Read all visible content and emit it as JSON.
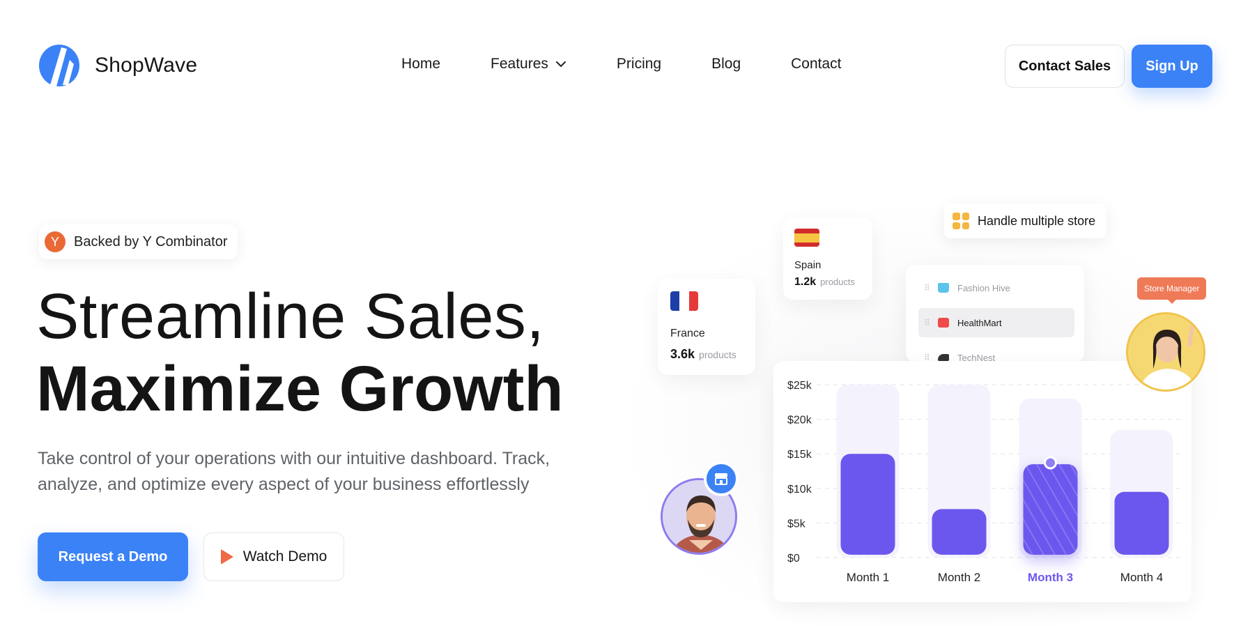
{
  "brand": {
    "name": "ShopWave",
    "accent": "#3b82f6"
  },
  "nav": {
    "items": [
      {
        "label": "Home"
      },
      {
        "label": "Features",
        "has_dropdown": true,
        "icon": "chevron-down-icon"
      },
      {
        "label": "Pricing"
      },
      {
        "label": "Blog"
      },
      {
        "label": "Contact"
      }
    ],
    "contact_sales": "Contact Sales",
    "sign_up": "Sign Up"
  },
  "hero": {
    "badge": {
      "icon_letter": "Y",
      "text": "Backed by Y Combinator"
    },
    "title_line1": "Streamline Sales,",
    "title_line2": "Maximize Growth",
    "subtitle": "Take control of your operations with our intuitive dashboard. Track, analyze, and optimize every aspect of your business effortlessly",
    "primary_cta": "Request a Demo",
    "secondary_cta": "Watch Demo"
  },
  "illustration": {
    "france": {
      "country": "France",
      "count": "3.6k",
      "unit": "products"
    },
    "spain": {
      "country": "Spain",
      "count": "1.2k",
      "unit": "products"
    },
    "handle_store": "Handle multiple store",
    "stores": [
      {
        "name": "Fashion Hive",
        "icon": "shirt-icon",
        "color": "#5cc4e8"
      },
      {
        "name": "HealthMart",
        "icon": "camera-icon",
        "color": "#ef4b4b",
        "selected": true
      },
      {
        "name": "TechNest",
        "icon": "sneaker-icon",
        "color": "#333333"
      }
    ],
    "store_manager": "Store Manager"
  },
  "chart_data": {
    "type": "bar",
    "categories": [
      "Month 1",
      "Month 2",
      "Month 3",
      "Month 4"
    ],
    "values": [
      15000,
      7000,
      13500,
      9500
    ],
    "background_values": [
      25000,
      25000,
      23000,
      18500
    ],
    "highlighted_index": 2,
    "ylim": [
      0,
      25000
    ],
    "yticks": [
      "$0",
      "$5k",
      "$10k",
      "$15k",
      "$20k",
      "$25k"
    ],
    "grid": true,
    "colors": {
      "bar": "#6b57ee",
      "track": "#f4f2fd",
      "highlight": "#6b57ee"
    }
  }
}
